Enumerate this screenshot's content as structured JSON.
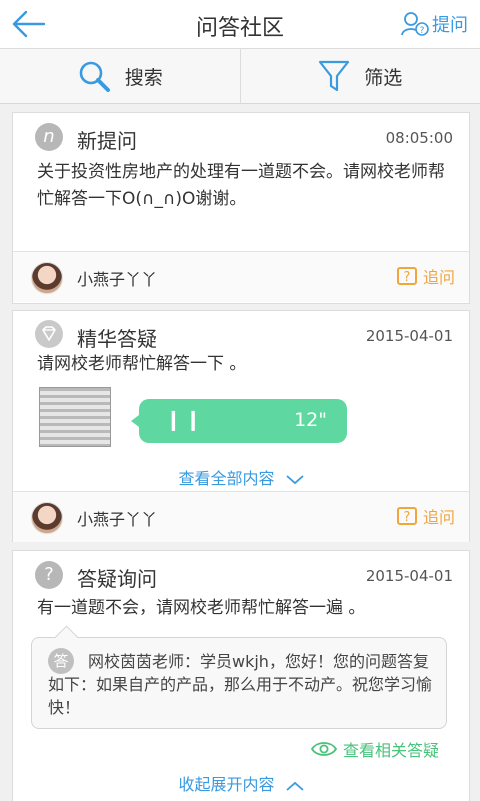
{
  "header": {
    "title": "问答社区",
    "ask_label": "提问",
    "back_icon": "arrow-left-icon",
    "ask_icon": "user-question-icon"
  },
  "toolbar": {
    "search_label": "搜索",
    "filter_label": "筛选",
    "search_icon": "search-icon",
    "filter_icon": "funnel-icon"
  },
  "cards": [
    {
      "badge": "n",
      "title": "新提问",
      "time": "08:05:00",
      "body": "关于投资性房地产的处理有一道题不会。请网校老师帮忙解答一下O(∩_∩)O谢谢。",
      "user": "小燕子丫丫",
      "action": "追问"
    },
    {
      "badge": "◇",
      "title": "精华答疑",
      "time": "2015-04-01",
      "body": "请网校老师帮忙解答一下 。",
      "voice_duration": "12\"",
      "expand_label": "查看全部内容",
      "user": "小燕子丫丫",
      "action": "追问"
    },
    {
      "badge": "?",
      "title": "答疑询问",
      "time": "2015-04-01",
      "body": "有一道题不会，请网校老师帮忙解答一遍 。",
      "reply_badge": "答",
      "reply": "网校茵茵老师：学员wkjh，您好！您的问题答复如下：如果自产的产品，那么用于不动产。祝您学习愉快！",
      "related_label": "查看相关答疑",
      "collapse_label": "收起展开内容"
    }
  ],
  "colors": {
    "accent_blue": "#3a9ae0",
    "voice_green": "#5ed8a0",
    "follow_orange": "#f0a63c",
    "related_green": "#49c27b"
  }
}
